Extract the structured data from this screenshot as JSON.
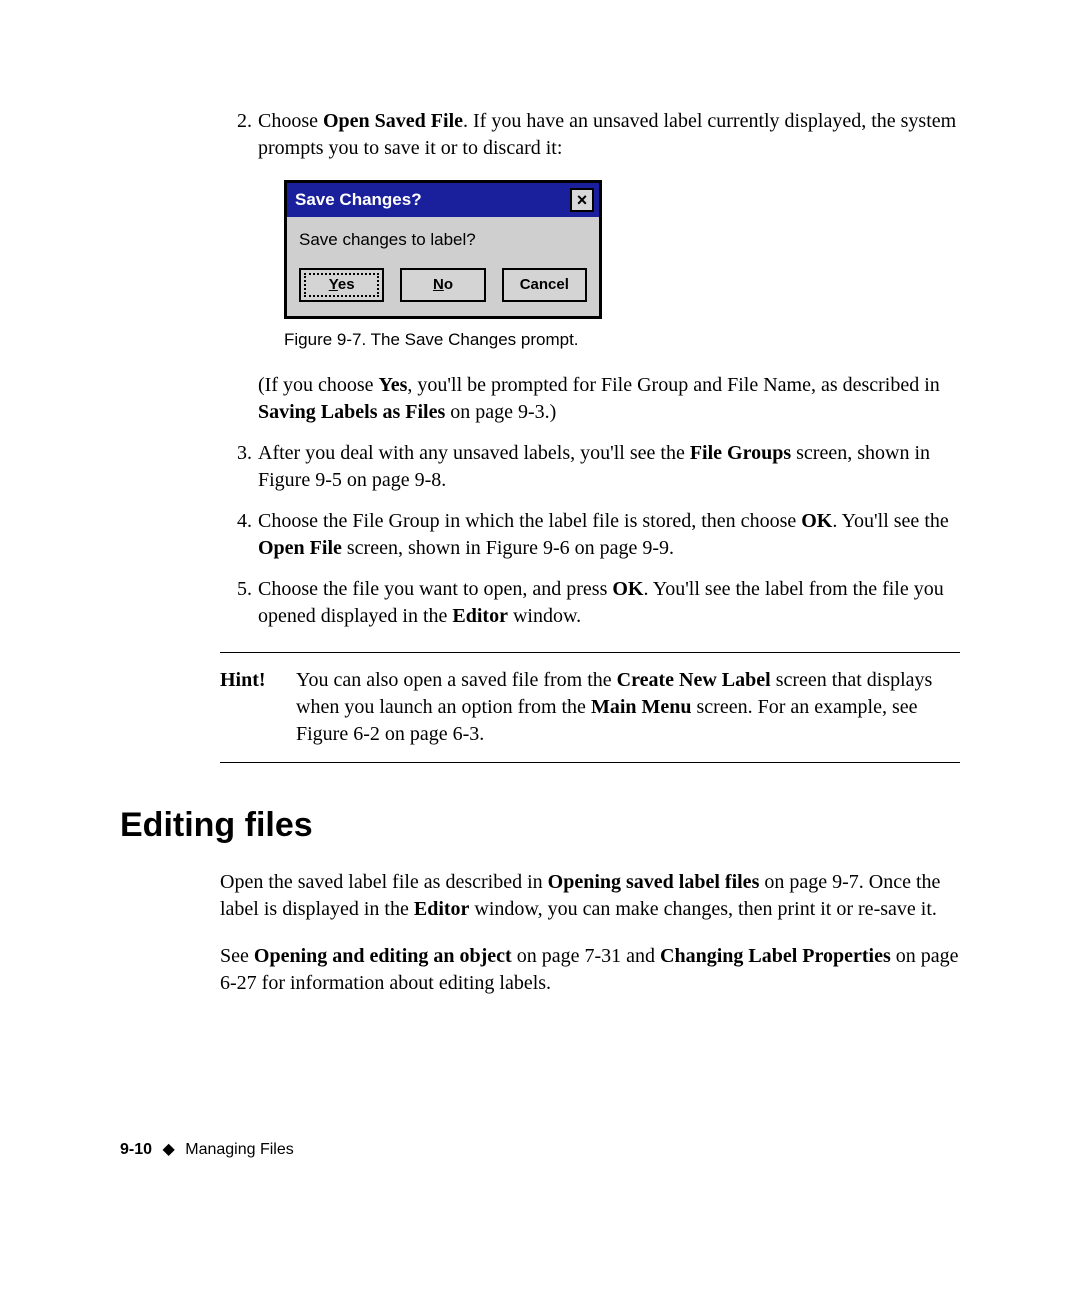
{
  "steps": {
    "s2": {
      "num": "2.",
      "pre": "Choose ",
      "bold1": "Open Saved File",
      "post": ". If you have an unsaved label currently displayed, the system prompts you to save it or to discard it:"
    },
    "s2b": {
      "pre": "(If you choose ",
      "bold1": "Yes",
      "mid": ", you'll be prompted for File Group and File Name, as described in ",
      "bold2": "Saving Labels as Files",
      "post": " on page 9-3.)"
    },
    "s3": {
      "num": "3.",
      "pre": "After you deal with any unsaved labels, you'll see the ",
      "bold1": "File Groups",
      "post": " screen, shown in Figure 9-5 on page 9-8."
    },
    "s4": {
      "num": "4.",
      "pre": "Choose the File Group in which the label file is stored, then choose ",
      "bold1": "OK",
      "mid": ". You'll see the ",
      "bold2": "Open File",
      "post": " screen, shown in Figure 9-6 on page 9-9."
    },
    "s5": {
      "num": "5.",
      "pre": "Choose the file you want to open, and press ",
      "bold1": "OK",
      "mid": ". You'll see the label from the file you opened displayed in the ",
      "bold2": "Editor",
      "post": " window."
    }
  },
  "dialog": {
    "title": "Save Changes?",
    "close": "×",
    "message": "Save changes to label?",
    "yes_u": "Y",
    "yes_rest": "es",
    "no_u": "N",
    "no_rest": "o",
    "cancel": "Cancel"
  },
  "caption": "Figure 9-7. The Save Changes prompt.",
  "hint": {
    "label": "Hint!",
    "pre": "You can also open a saved file from the ",
    "bold1": "Create New Label",
    "mid": " screen that displays when you launch an option from the ",
    "bold2": "Main Menu",
    "post": " screen. For an example, see Figure 6-2 on page 6-3."
  },
  "section_heading": "Editing files",
  "editing": {
    "p1_pre": "Open the saved label file as described in ",
    "p1_b1": "Opening saved label files",
    "p1_mid": " on page 9-7. Once the label is displayed in the ",
    "p1_b2": "Editor",
    "p1_post": " window, you can make changes, then print it or re-save it.",
    "p2_pre": "See ",
    "p2_b1": "Opening and editing an object",
    "p2_mid": " on page 7-31 and ",
    "p2_b2": "Changing Label Properties",
    "p2_post": " on page 6-27 for information about editing labels."
  },
  "footer": {
    "page_num": "9-10",
    "diamond": "◆",
    "chapter": "Managing Files"
  }
}
